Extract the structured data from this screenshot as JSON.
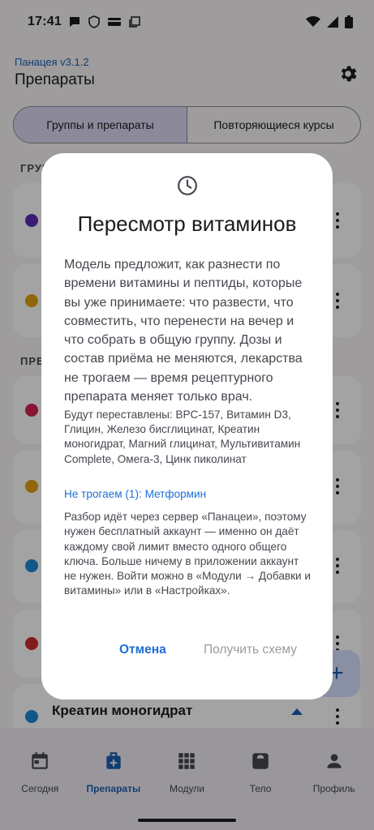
{
  "status_bar": {
    "time": "17:41"
  },
  "app": {
    "version": "Панацея v3.1.2",
    "title": "Препараты"
  },
  "segments": [
    {
      "label": "Группы и препараты",
      "active": true
    },
    {
      "label": "Повторяющиеся курсы",
      "active": false
    }
  ],
  "sections": {
    "groups": "ГРУППЫ",
    "preparations": "ПРЕПАРАТЫ"
  },
  "background_items": {
    "last_visible_title": "Креатин моногидрат",
    "dot_colors": [
      "#5b2bb5",
      "#e0a010",
      "#d4234f",
      "#e0a010",
      "#1c8ad6",
      "#cf2b2b",
      "#1c8ad6"
    ]
  },
  "fab": {
    "icon": "plus-icon",
    "label": "+"
  },
  "bottom_nav": [
    {
      "label": "Сегодня",
      "icon": "calendar-icon",
      "active": false
    },
    {
      "label": "Препараты",
      "icon": "medical-kit-icon",
      "active": true
    },
    {
      "label": "Модули",
      "icon": "grid-icon",
      "active": false
    },
    {
      "label": "Тело",
      "icon": "scale-icon",
      "active": false
    },
    {
      "label": "Профиль",
      "icon": "person-icon",
      "active": false
    }
  ],
  "dialog": {
    "icon": "clock-icon",
    "title": "Пересмотр витаминов",
    "body": "Модель предложит, как разнести по времени витамины и пептиды, которые вы уже принимаете: что развести, что совместить, что перенести на вечер и что собрать в общую группу. Дозы и состав приёма не меняются, лекарства не трогаем — время рецептурного препарата меняет только врач.",
    "list": "Будут переставлены: BPC-157, Витамин D3, Глицин, Железо бисглицинат, Креатин моногидрат, Магний глицинат, Мультивитамин Complete, Омега-3, Цинк пиколинат",
    "untouched": "Не трогаем (1): Метформин",
    "note": "Разбор идёт через сервер «Панацеи», поэтому нужен бесплатный аккаунт — именно он даёт каждому свой лимит вместо одного общего ключа. Больше ничему в приложении аккаунт не нужен. Войти можно в «Модули → Добавки и витамины» или в «Настройках».",
    "cancel": "Отмена",
    "confirm": "Получить схему"
  },
  "colors": {
    "accent": "#1c6fd6",
    "scrim": "rgba(0,0,0,0.36)",
    "surface": "#ffffff"
  }
}
